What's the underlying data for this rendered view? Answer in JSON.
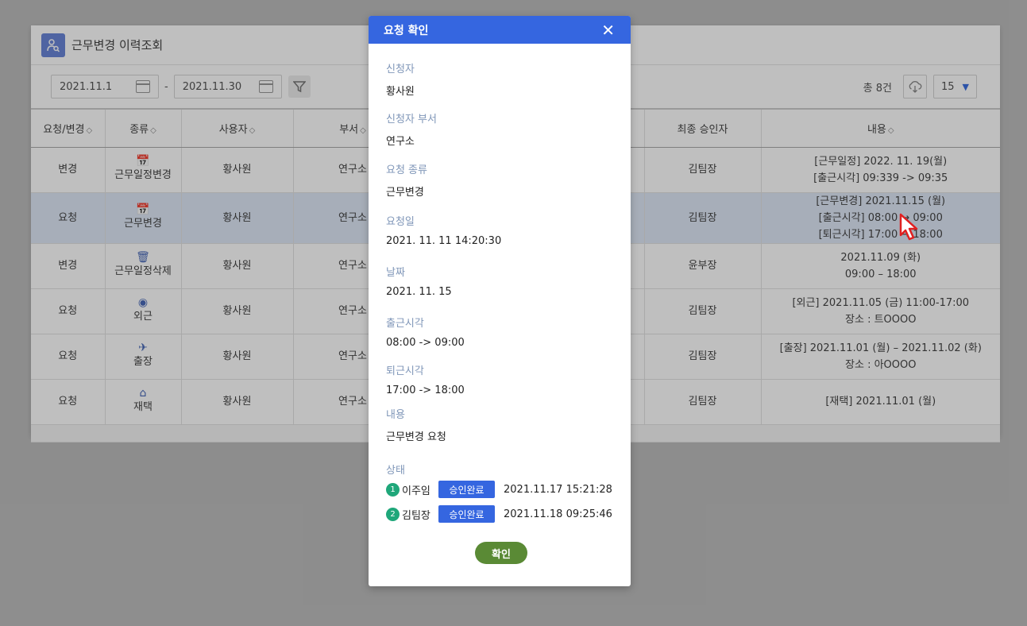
{
  "panel": {
    "title": "근무변경 이력조회",
    "date_from": "2021.11.1",
    "date_sep": "-",
    "date_to": "2021.11.30",
    "total": "총 8건",
    "page_size": "15"
  },
  "table": {
    "headers": [
      "요청/변경",
      "종류",
      "사용자",
      "부서",
      "",
      "최종 승인자",
      "내용"
    ],
    "sort_arrow": "◇",
    "rows": [
      {
        "kind": "변경",
        "type": "근무일정변경",
        "icon": "calendar-edit-icon",
        "user": "황사원",
        "dept": "연구소",
        "approver": "김팀장",
        "content1": "[근무일정] 2022. 11. 19(월)",
        "content2": "[출근시각] 09:339 -> 09:35",
        "content3": ""
      },
      {
        "kind": "요청",
        "type": "근무변경",
        "icon": "calendar-edit-icon",
        "user": "황사원",
        "dept": "연구소",
        "approver": "김팀장",
        "content1": "[근무변경] 2021.11.15 (월)",
        "content2": "[출근시각] 08:00 → 09:00",
        "content3": "[퇴근시각] 17:00 → 18:00"
      },
      {
        "kind": "변경",
        "type": "근무일정삭제",
        "icon": "trash-icon",
        "user": "황사원",
        "dept": "연구소",
        "approver": "윤부장",
        "content1": "2021.11.09 (화)",
        "content2": "09:00 – 18:00",
        "content3": ""
      },
      {
        "kind": "요청",
        "type": "외근",
        "icon": "location-pin-icon",
        "user": "황사원",
        "dept": "연구소",
        "approver": "김팀장",
        "content1": "[외근] 2021.11.05 (금) 11:00-17:00",
        "content2": "장소 : 트OOOO",
        "content3": ""
      },
      {
        "kind": "요청",
        "type": "출장",
        "icon": "airplane-icon",
        "user": "황사원",
        "dept": "연구소",
        "approver": "김팀장",
        "content1": "[출장] 2021.11.01 (월) – 2021.11.02 (화)",
        "content2": "장소 : 아OOOO",
        "content3": ""
      },
      {
        "kind": "요청",
        "type": "재택",
        "icon": "home-icon",
        "user": "황사원",
        "dept": "연구소",
        "approver": "김팀장",
        "content1": "[재택] 2021.11.01 (월)",
        "content2": "",
        "content3": ""
      }
    ]
  },
  "modal": {
    "title": "요청 확인",
    "fields": [
      {
        "label": "신청자",
        "value": "황사원"
      },
      {
        "label": "신청자 부서",
        "value": "연구소"
      },
      {
        "label": "요청 종류",
        "value": "근무변경"
      },
      {
        "label": "요청일",
        "value": "2021. 11. 11  14:20:30"
      },
      {
        "label": "날짜",
        "value": "2021. 11. 15"
      },
      {
        "label": "출근시각",
        "value": "08:00 -> 09:00"
      },
      {
        "label": "퇴근시각",
        "value": "17:00 -> 18:00"
      },
      {
        "label": "내용",
        "value": "근무변경 요청"
      }
    ],
    "status_label": "상태",
    "status": [
      {
        "step": "1",
        "name": "이주임",
        "badge": "승인완료",
        "time": "2021.11.17  15:21:28"
      },
      {
        "step": "2",
        "name": "김팀장",
        "badge": "승인완료",
        "time": "2021.11.18  09:25:46"
      }
    ],
    "confirm_label": "확인"
  }
}
